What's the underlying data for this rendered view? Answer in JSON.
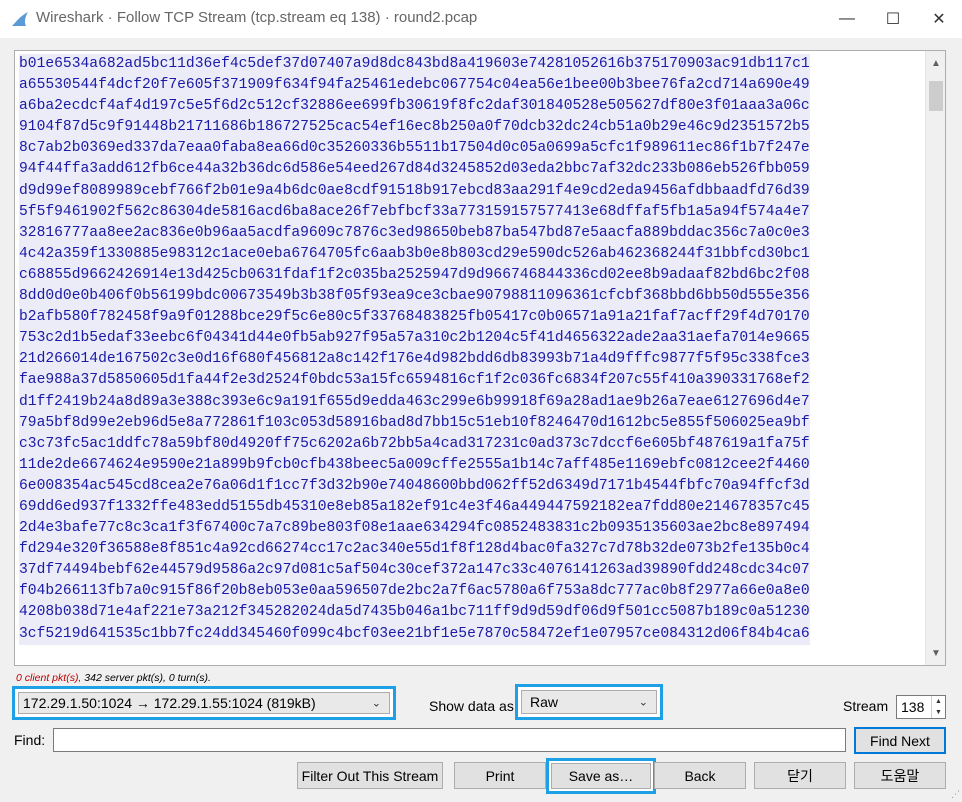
{
  "window": {
    "title": "Wireshark · Follow TCP Stream (tcp.stream eq 138) · round2.pcap",
    "minimize_glyph": "—",
    "maximize_glyph": "☐",
    "close_glyph": "✕"
  },
  "stream": {
    "lines": [
      "b01e6534a682ad5bc11d36ef4c5def37d07407a9d8dc843bd8a419603e74281052616b375170903ac91db117c1",
      "a65530544f4dcf20f7e605f371909f634f94fa25461edebc067754c04ea56e1bee00b3bee76fa2cd714a690e49",
      "a6ba2ecdcf4af4d197c5e5f6d2c512cf32886ee699fb30619f8fc2daf301840528e505627df80e3f01aaa3a06c",
      "9104f87d5c9f91448b21711686b186727525cac54ef16ec8b250a0f70dcb32dc24cb51a0b29e46c9d2351572b5",
      "8c7ab2b0369ed337da7eaa0faba8ea66d0c35260336b5511b17504d0c05a0699a5cfc1f989611ec86f1b7f247e",
      "94f44ffa3add612fb6ce44a32b36dc6d586e54eed267d84d3245852d03eda2bbc7af32dc233b086eb526fbb059",
      "d9d99ef8089989cebf766f2b01e9a4b6dc0ae8cdf91518b917ebcd83aa291f4e9cd2eda9456afdbbaadfd76d39",
      "5f5f9461902f562c86304de5816acd6ba8ace26f7ebfbcf33a773159157577413e68dffaf5fb1a5a94f574a4e7",
      "32816777aa8ee2ac836e0b96aa5acdfa9609c7876c3ed98650beb87ba547bd87e5aacfa889bddac356c7a0c0e3",
      "4c42a359f1330885e98312c1ace0eba6764705fc6aab3b0e8b803cd29e590dc526ab462368244f31bbfcd30bc1",
      "c68855d9662426914e13d425cb0631fdaf1f2c035ba2525947d9d966746844336cd02ee8b9adaaf82bd6bc2f08",
      "8dd0d0e0b406f0b56199bdc00673549b3b38f05f93ea9ce3cbae9079881109636​1cfcbf368bbd6bb50d555e356",
      "b2afb580f782458f9a9f01288bce29f5c6e80c5f33768483825fb05417c0b06571a91a21faf7acff29f4d70170",
      "753c2d1b5edaf33eebc6f04341d44e0fb5ab927f95a57a310c2b1204c5f41d4656322ade2aa31aefa7014e9665",
      "21d266014de167502c3e0d16f680f456812a8c142f176e4d982bdd6db83993b71a4d9fffc9877f5f95c338fce3",
      "fae988a37d5850605d1fa44f2e3d2524f0bdc53a15fc6594816cf1f2c036fc6834f207c55f410a390331768ef2",
      "d1ff2419b24a8d89a3e388c393e6c9a191f655d9edda463c299e6b99918f69a28ad1ae9b26a7eae6127696d4e7",
      "79a5bf8d99e2eb96d5e8a772861f103c053d58916bad8d7bb15c51eb10f8246470d1612bc5e855f506025ea9bf",
      "c3c73fc5ac1ddfc78a59bf80d4920ff75c6202a6b72bb5a4cad317231c0ad373c7dccf6e605bf487619a1fa75f",
      "11de2de6674624e9590e21a899b9fcb0cfb438beec5a009cffe2555a1b14c7aff485e1169ebfc0812cee2f4460",
      "6e008354ac545cd8cea2e76a06d1f1cc7f3d32b90e74048600bbd062ff52d6349d7171b4544fbfc70a94ffcf3d",
      "69dd6ed937f1332ffe483edd5155db45310e8eb85a182ef91c4e3f46a449447592182ea7fdd80e214678357c45",
      "2d4e3bafe77c8c3ca1f3f67400c7a7c89be803f08e1aae634294fc0852483831c2b0935135603ae2bc8e897494",
      "fd294e320f36588e8f851c4a92cd66274cc17c2ac340e55d1f8f128d4bac0fa327c7d78b32de073b2fe135b0c4",
      "37df74494bebf62e44579d9586a2c97d081c5af504c30cef372a147c33c4076141263ad39890fdd248cdc34c07",
      "f04b266113fb7a0c915f86f20b8eb053e0aa596507de2bc2a7f6ac5780a6f753a8dc777ac0b8f2977a66e0a8e0",
      "4208b038d71e4af221e73a212f345282024da5d7435b046a1bc711ff9d9d59df06d9f501cc5087b189c0a51230",
      "3cf5219d641535c1bb7fc24dd345460f099c4bcf03ee21bf1e5e7870c58472ef1e07957ce084312d06f84b4ca6"
    ]
  },
  "summary": {
    "client": "0 client pkt(s),",
    "rest": " 342 server pkt(s), 0 turn(s)."
  },
  "controls": {
    "conversation": "172.29.1.50:1024 → 172.29.1.55:1024 (819kB)",
    "show_data_label": "Show data as",
    "show_data_value": "Raw",
    "stream_label": "Stream",
    "stream_value": "138",
    "find_label": "Find:",
    "find_value": "",
    "find_next": "Find Next"
  },
  "buttons": {
    "filter_out": "Filter Out This Stream",
    "print": "Print",
    "save_as": "Save as…",
    "back": "Back",
    "close": "닫기",
    "help": "도움말"
  },
  "colors": {
    "highlight": "#1ea0e6",
    "stream_text": "#1a1aa6",
    "stream_bg": "#ececf8",
    "client_summary": "#c00000"
  }
}
